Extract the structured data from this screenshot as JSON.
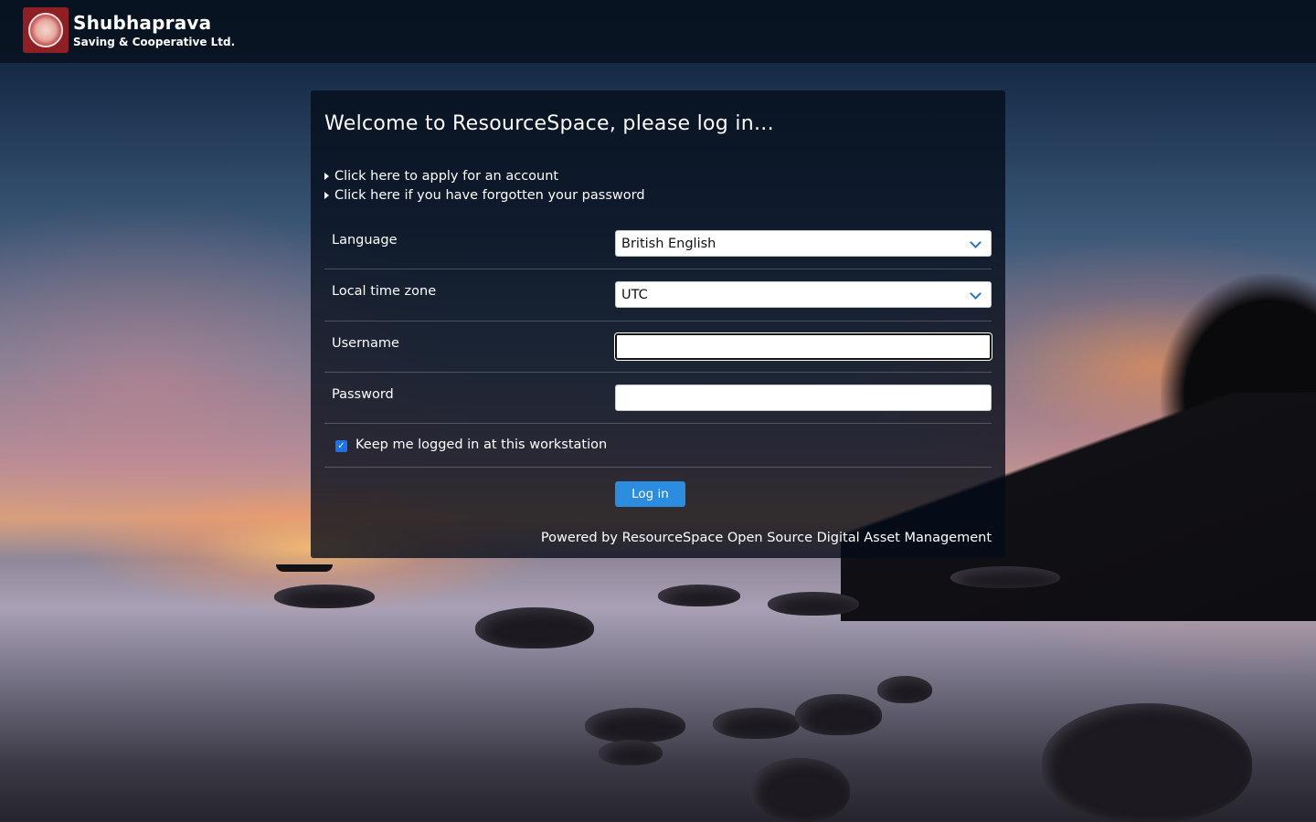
{
  "header": {
    "logo_title": "Shubhaprava",
    "logo_subtitle": "Saving & Cooperative Ltd.",
    "logo_icon": "cooperative-emblem"
  },
  "login": {
    "title": "Welcome to ResourceSpace, please log in...",
    "links": [
      {
        "label": "Click here to apply for an account"
      },
      {
        "label": "Click here if you have forgotten your password"
      }
    ],
    "fields": {
      "language": {
        "label": "Language",
        "value": "British English"
      },
      "timezone": {
        "label": "Local time zone",
        "value": "UTC"
      },
      "username": {
        "label": "Username",
        "value": "",
        "placeholder": ""
      },
      "password": {
        "label": "Password",
        "value": "",
        "placeholder": ""
      }
    },
    "keep_logged_in": {
      "label": "Keep me logged in at this workstation",
      "checked": true
    },
    "submit_label": "Log in",
    "powered_prefix": "Powered by ",
    "powered_link": "ResourceSpace Open Source Digital Asset Management"
  },
  "colors": {
    "accent": "#2b8ce0",
    "checkbox": "#1a73e8",
    "panel_bg": "#040c18"
  }
}
